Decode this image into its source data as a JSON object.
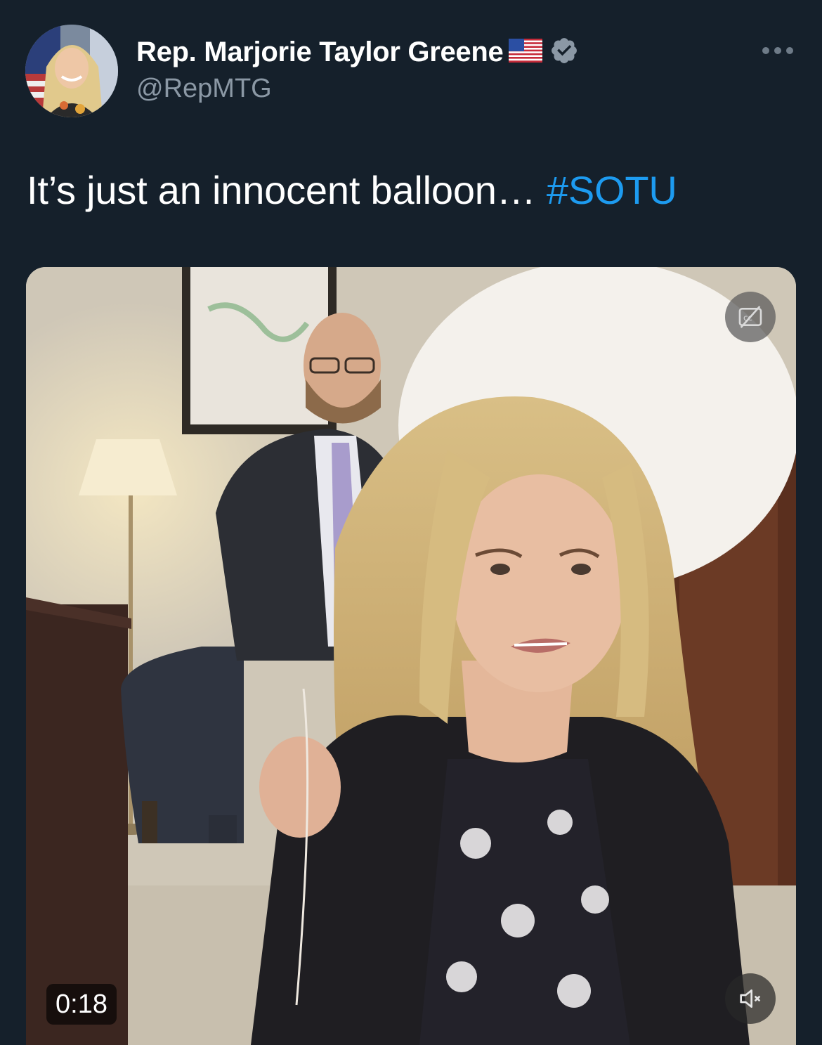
{
  "tweet": {
    "display_name": "Rep. Marjorie Taylor Greene",
    "handle": "@RepMTG",
    "text": "It’s just an innocent balloon… ",
    "hashtag": "#SOTU"
  },
  "media": {
    "duration": "0:18"
  },
  "icons": {
    "flag": "us-flag-icon",
    "verified": "verified-badge-icon",
    "more": "more-options-icon",
    "captions": "captions-off-icon",
    "mute": "volume-muted-icon"
  },
  "colors": {
    "background": "#15202b",
    "text": "#ffffff",
    "secondary_text": "#8b98a5",
    "link": "#1d9bf0"
  }
}
